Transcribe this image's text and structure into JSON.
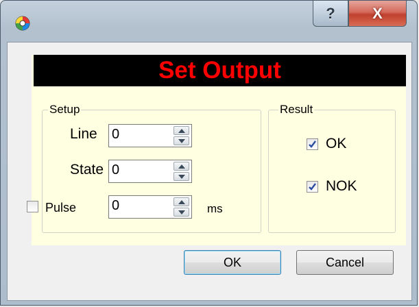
{
  "window": {
    "app_icon": "app-logo-icon",
    "help_label": "?",
    "close_label": "X"
  },
  "header": {
    "title": "Set Output"
  },
  "setup": {
    "group_label": "Setup",
    "line_label": "Line",
    "line_value": "0",
    "state_label": "State",
    "state_value": "0",
    "pulse_checked": false,
    "pulse_label": "Pulse",
    "pulse_value": "0",
    "pulse_unit": "ms"
  },
  "result": {
    "group_label": "Result",
    "ok_checked": true,
    "ok_label": "OK",
    "nok_checked": true,
    "nok_label": "NOK"
  },
  "buttons": {
    "ok_label": "OK",
    "cancel_label": "Cancel"
  },
  "colors": {
    "header_background": "#000000",
    "header_text": "#ff0000",
    "panel_background": "#ffffe1",
    "close_button": "#c0402e"
  }
}
